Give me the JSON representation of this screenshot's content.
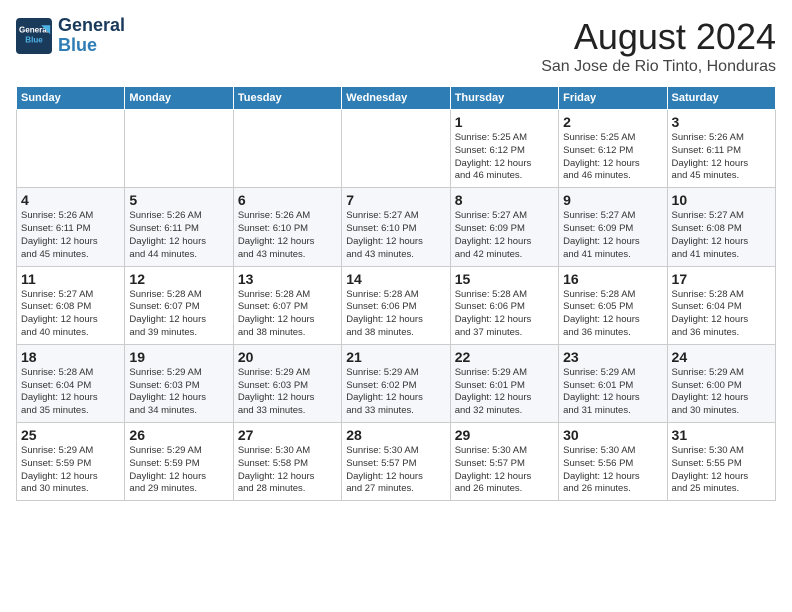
{
  "header": {
    "logo_line1": "General",
    "logo_line2": "Blue",
    "month_year": "August 2024",
    "location": "San Jose de Rio Tinto, Honduras"
  },
  "weekdays": [
    "Sunday",
    "Monday",
    "Tuesday",
    "Wednesday",
    "Thursday",
    "Friday",
    "Saturday"
  ],
  "weeks": [
    [
      {
        "num": "",
        "detail": ""
      },
      {
        "num": "",
        "detail": ""
      },
      {
        "num": "",
        "detail": ""
      },
      {
        "num": "",
        "detail": ""
      },
      {
        "num": "1",
        "detail": "Sunrise: 5:25 AM\nSunset: 6:12 PM\nDaylight: 12 hours\nand 46 minutes."
      },
      {
        "num": "2",
        "detail": "Sunrise: 5:25 AM\nSunset: 6:12 PM\nDaylight: 12 hours\nand 46 minutes."
      },
      {
        "num": "3",
        "detail": "Sunrise: 5:26 AM\nSunset: 6:11 PM\nDaylight: 12 hours\nand 45 minutes."
      }
    ],
    [
      {
        "num": "4",
        "detail": "Sunrise: 5:26 AM\nSunset: 6:11 PM\nDaylight: 12 hours\nand 45 minutes."
      },
      {
        "num": "5",
        "detail": "Sunrise: 5:26 AM\nSunset: 6:11 PM\nDaylight: 12 hours\nand 44 minutes."
      },
      {
        "num": "6",
        "detail": "Sunrise: 5:26 AM\nSunset: 6:10 PM\nDaylight: 12 hours\nand 43 minutes."
      },
      {
        "num": "7",
        "detail": "Sunrise: 5:27 AM\nSunset: 6:10 PM\nDaylight: 12 hours\nand 43 minutes."
      },
      {
        "num": "8",
        "detail": "Sunrise: 5:27 AM\nSunset: 6:09 PM\nDaylight: 12 hours\nand 42 minutes."
      },
      {
        "num": "9",
        "detail": "Sunrise: 5:27 AM\nSunset: 6:09 PM\nDaylight: 12 hours\nand 41 minutes."
      },
      {
        "num": "10",
        "detail": "Sunrise: 5:27 AM\nSunset: 6:08 PM\nDaylight: 12 hours\nand 41 minutes."
      }
    ],
    [
      {
        "num": "11",
        "detail": "Sunrise: 5:27 AM\nSunset: 6:08 PM\nDaylight: 12 hours\nand 40 minutes."
      },
      {
        "num": "12",
        "detail": "Sunrise: 5:28 AM\nSunset: 6:07 PM\nDaylight: 12 hours\nand 39 minutes."
      },
      {
        "num": "13",
        "detail": "Sunrise: 5:28 AM\nSunset: 6:07 PM\nDaylight: 12 hours\nand 38 minutes."
      },
      {
        "num": "14",
        "detail": "Sunrise: 5:28 AM\nSunset: 6:06 PM\nDaylight: 12 hours\nand 38 minutes."
      },
      {
        "num": "15",
        "detail": "Sunrise: 5:28 AM\nSunset: 6:06 PM\nDaylight: 12 hours\nand 37 minutes."
      },
      {
        "num": "16",
        "detail": "Sunrise: 5:28 AM\nSunset: 6:05 PM\nDaylight: 12 hours\nand 36 minutes."
      },
      {
        "num": "17",
        "detail": "Sunrise: 5:28 AM\nSunset: 6:04 PM\nDaylight: 12 hours\nand 36 minutes."
      }
    ],
    [
      {
        "num": "18",
        "detail": "Sunrise: 5:28 AM\nSunset: 6:04 PM\nDaylight: 12 hours\nand 35 minutes."
      },
      {
        "num": "19",
        "detail": "Sunrise: 5:29 AM\nSunset: 6:03 PM\nDaylight: 12 hours\nand 34 minutes."
      },
      {
        "num": "20",
        "detail": "Sunrise: 5:29 AM\nSunset: 6:03 PM\nDaylight: 12 hours\nand 33 minutes."
      },
      {
        "num": "21",
        "detail": "Sunrise: 5:29 AM\nSunset: 6:02 PM\nDaylight: 12 hours\nand 33 minutes."
      },
      {
        "num": "22",
        "detail": "Sunrise: 5:29 AM\nSunset: 6:01 PM\nDaylight: 12 hours\nand 32 minutes."
      },
      {
        "num": "23",
        "detail": "Sunrise: 5:29 AM\nSunset: 6:01 PM\nDaylight: 12 hours\nand 31 minutes."
      },
      {
        "num": "24",
        "detail": "Sunrise: 5:29 AM\nSunset: 6:00 PM\nDaylight: 12 hours\nand 30 minutes."
      }
    ],
    [
      {
        "num": "25",
        "detail": "Sunrise: 5:29 AM\nSunset: 5:59 PM\nDaylight: 12 hours\nand 30 minutes."
      },
      {
        "num": "26",
        "detail": "Sunrise: 5:29 AM\nSunset: 5:59 PM\nDaylight: 12 hours\nand 29 minutes."
      },
      {
        "num": "27",
        "detail": "Sunrise: 5:30 AM\nSunset: 5:58 PM\nDaylight: 12 hours\nand 28 minutes."
      },
      {
        "num": "28",
        "detail": "Sunrise: 5:30 AM\nSunset: 5:57 PM\nDaylight: 12 hours\nand 27 minutes."
      },
      {
        "num": "29",
        "detail": "Sunrise: 5:30 AM\nSunset: 5:57 PM\nDaylight: 12 hours\nand 26 minutes."
      },
      {
        "num": "30",
        "detail": "Sunrise: 5:30 AM\nSunset: 5:56 PM\nDaylight: 12 hours\nand 26 minutes."
      },
      {
        "num": "31",
        "detail": "Sunrise: 5:30 AM\nSunset: 5:55 PM\nDaylight: 12 hours\nand 25 minutes."
      }
    ]
  ]
}
